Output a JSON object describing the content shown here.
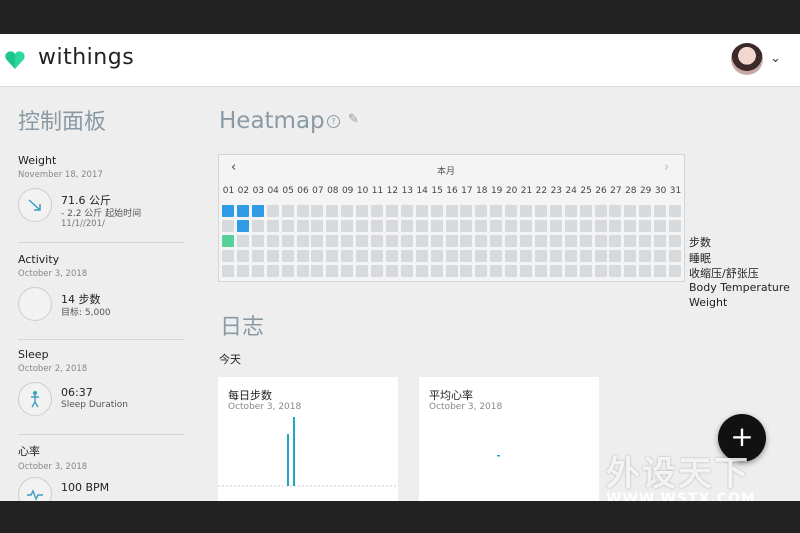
{
  "app": {
    "brand": "withings",
    "brand_color": "#2bd8a0"
  },
  "sidebar": {
    "title": "控制面板",
    "sections": [
      {
        "name": "Weight",
        "date": "November 18, 2017",
        "icon": "trend-down-icon",
        "main": "71.6 公斤",
        "sub": "- 2.2 公斤 起始时间",
        "sub2": "11/1//201/"
      },
      {
        "name": "Activity",
        "date": "October 3, 2018",
        "icon": "empty-circle",
        "main": "14 步数",
        "sub": "目标: 5,000",
        "sub2": ""
      },
      {
        "name": "Sleep",
        "date": "October 2, 2018",
        "icon": "sleep-figure-icon",
        "main": "06:37",
        "sub": "Sleep Duration",
        "sub2": ""
      },
      {
        "name": "心率",
        "date": "October 3, 2018",
        "icon": "heart-pulse-icon",
        "main": "100 BPM",
        "sub": "",
        "sub2": ""
      }
    ]
  },
  "heatmap": {
    "title": "Heatmap",
    "month_label": "本月",
    "days": [
      "01",
      "02",
      "03",
      "04",
      "05",
      "06",
      "07",
      "08",
      "09",
      "10",
      "11",
      "12",
      "13",
      "14",
      "15",
      "16",
      "17",
      "18",
      "19",
      "20",
      "21",
      "22",
      "23",
      "24",
      "25",
      "26",
      "27",
      "28",
      "29",
      "30",
      "31"
    ],
    "rows": [
      "步数",
      "睡眠",
      "收缩压/舒张压",
      "Body Temperature",
      "Weight"
    ],
    "active_cells": [
      {
        "row": 0,
        "day": 1,
        "color": "#2f9ae6"
      },
      {
        "row": 0,
        "day": 2,
        "color": "#2f9ae6"
      },
      {
        "row": 0,
        "day": 3,
        "color": "#2f9ae6"
      },
      {
        "row": 1,
        "day": 2,
        "color": "#2f9ae6"
      },
      {
        "row": 2,
        "day": 1,
        "color": "#55d19a"
      }
    ]
  },
  "journal": {
    "title": "日志",
    "today_label": "今天",
    "cards": [
      {
        "title": "每日步数",
        "date": "October 3, 2018"
      },
      {
        "title": "平均心率",
        "date": "October 3, 2018"
      }
    ]
  },
  "fab_label": "+",
  "watermark": {
    "text": "外设天下",
    "url": "WWW.WSTX.COM"
  }
}
